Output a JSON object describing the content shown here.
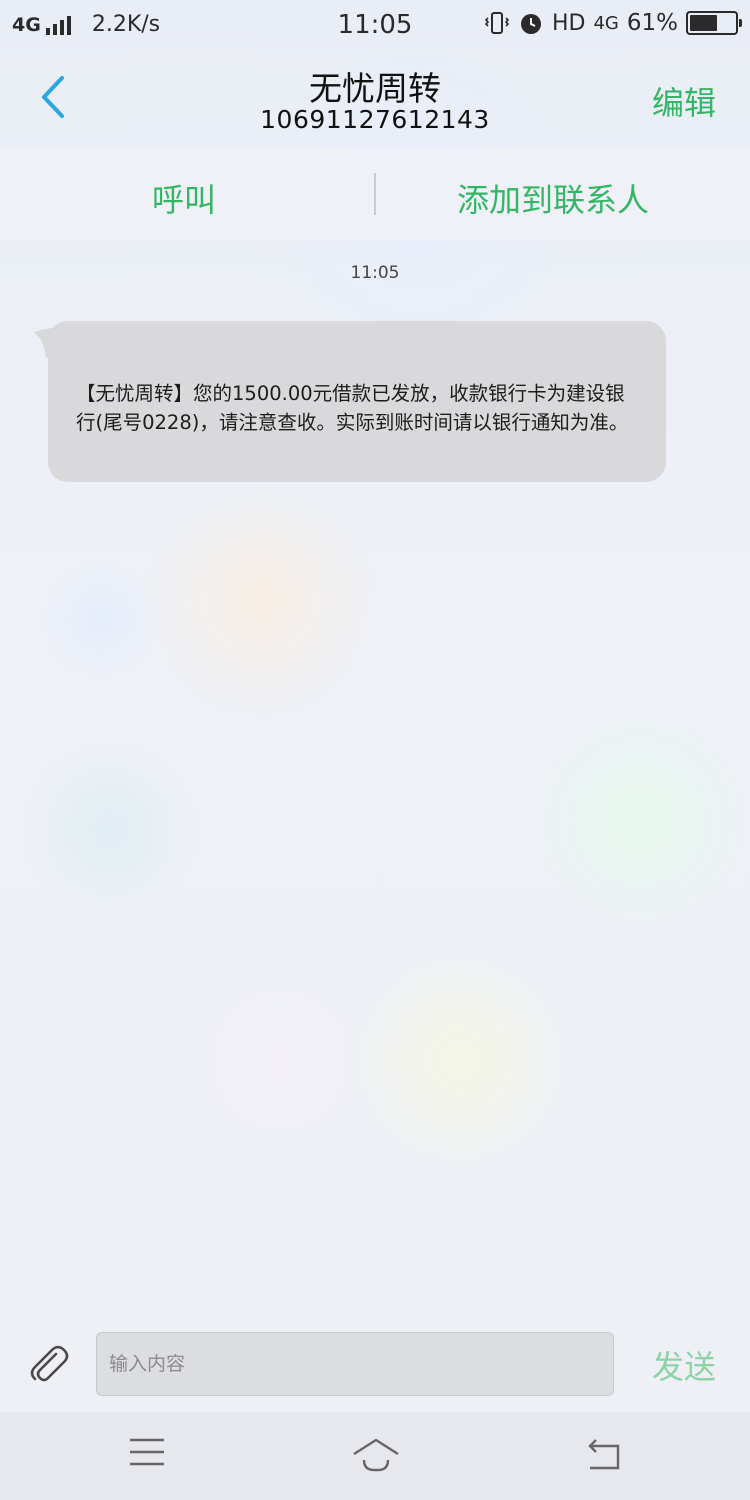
{
  "status_bar": {
    "network": "4G",
    "speed": "2.2K/s",
    "time": "11:05",
    "hd": "HD",
    "network2": "4G",
    "battery_percent": "61%",
    "battery_level": 0.61
  },
  "header": {
    "title": "无忧周转",
    "number": "10691127612143",
    "edit_label": "编辑"
  },
  "actions": {
    "call_label": "呼叫",
    "add_contact_label": "添加到联系人"
  },
  "conversation": {
    "timestamp": "11:05",
    "messages": [
      {
        "direction": "incoming",
        "text": "【无忧周转】您的1500.00元借款已发放，收款银行卡为建设银行(尾号0228)，请注意查收。实际到账时间请以银行通知为准。"
      }
    ]
  },
  "composer": {
    "placeholder": "输入内容",
    "send_label": "发送"
  },
  "colors": {
    "accent": "#35b566",
    "send_disabled": "#8fd2a6",
    "back_arrow": "#2aa6e0",
    "bubble": "#d9d9dc"
  },
  "icons": {
    "back": "chevron-left-icon",
    "attach": "paperclip-icon",
    "menu": "menu-icon",
    "home": "home-icon",
    "return": "return-icon"
  }
}
